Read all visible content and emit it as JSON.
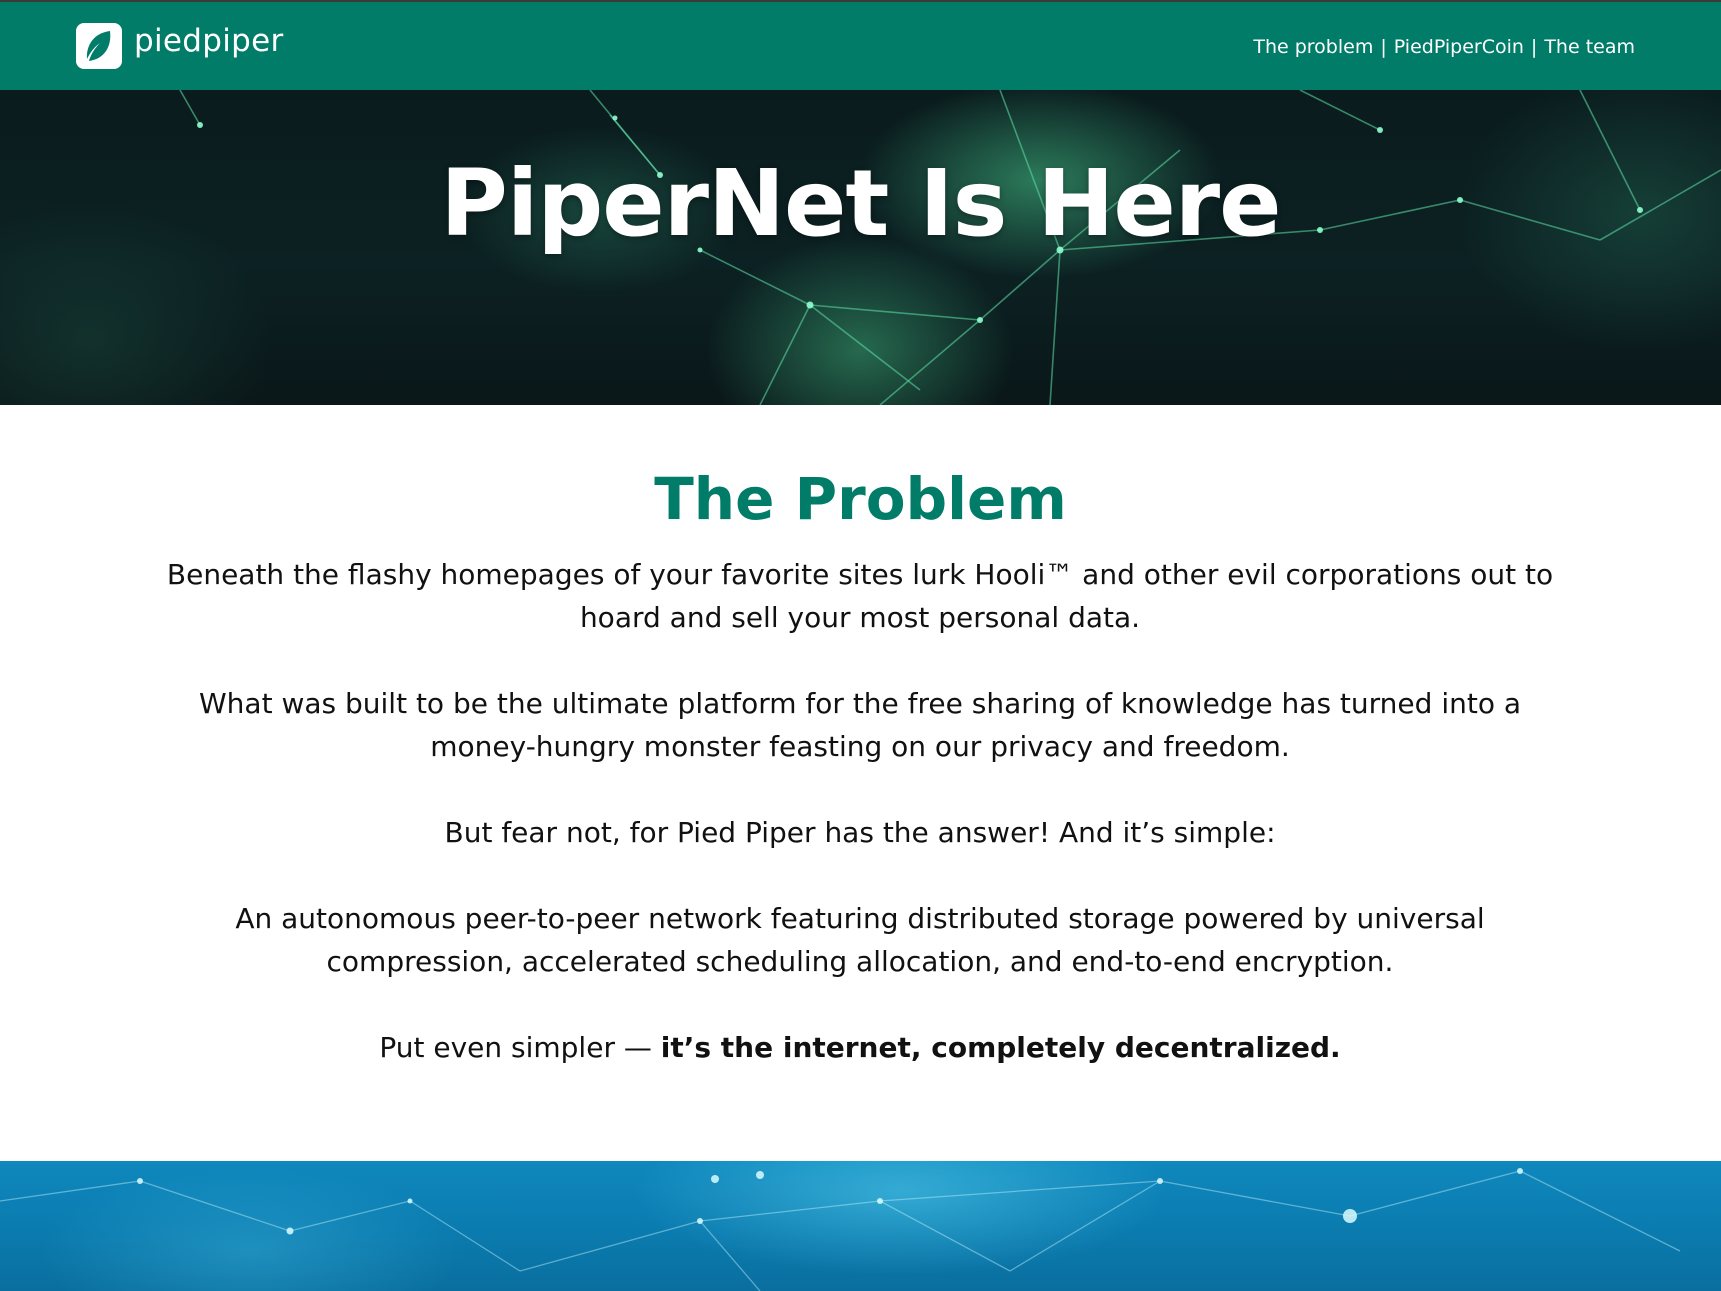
{
  "header": {
    "brand_name": "piedpiper",
    "nav": [
      {
        "label": "The problem"
      },
      {
        "label": "PiedPiperCoin"
      },
      {
        "label": "The team"
      }
    ],
    "separator": "|"
  },
  "hero": {
    "title": "PiperNet Is Here"
  },
  "problem": {
    "title": "The Problem",
    "paragraphs": [
      "Beneath the flashy homepages of your favorite sites lurk Hooli™ and other evil corporations out to hoard and sell your most personal data.",
      "What was built to be the ultimate platform for the free sharing of knowledge has turned into a money-hungry monster feasting on our privacy and freedom.",
      "But fear not, for Pied Piper has the answer! And it’s simple:",
      "An autonomous peer-to-peer network featuring distributed storage powered by universal compression, accelerated scheduling allocation, and end-to-end encryption."
    ],
    "closing_prefix": "Put even simpler — ",
    "closing_emphasis": "it’s the internet, completely decentralized."
  },
  "colors": {
    "brand_green": "#007c68",
    "footer_blue": "#0b7cb0"
  }
}
